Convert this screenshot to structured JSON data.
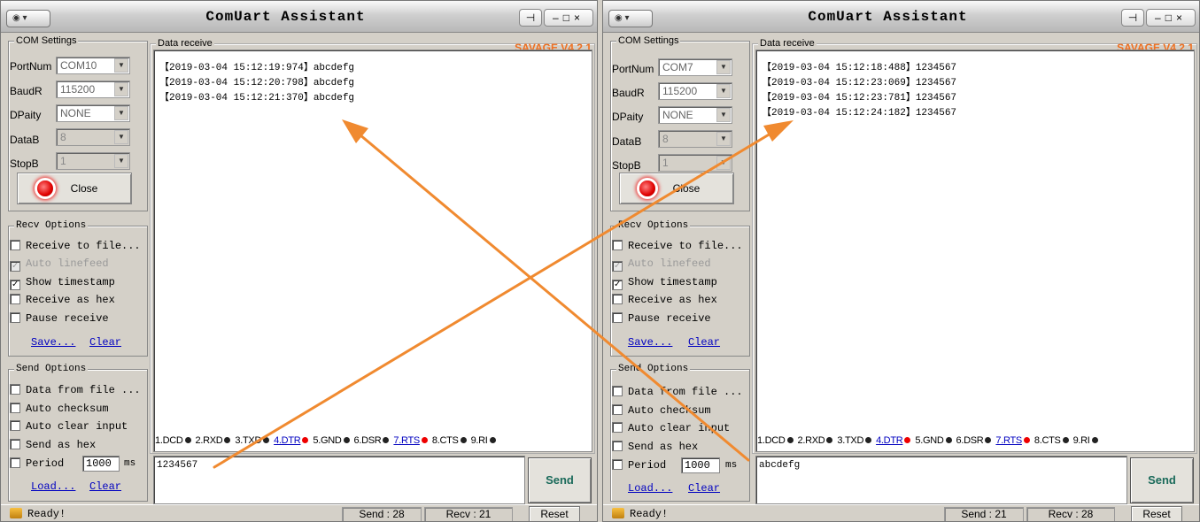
{
  "windows": [
    {
      "title": "ComUart Assistant",
      "brand": "SAVAGE V4.2.1",
      "com_settings": {
        "group_label": "COM Settings",
        "port_label": "PortNum",
        "port_value": "COM10",
        "baud_label": "BaudR",
        "baud_value": "115200",
        "parity_label": "DPaity",
        "parity_value": "NONE",
        "databits_label": "DataB",
        "databits_value": "8",
        "stopbits_label": "StopB",
        "stopbits_value": "1",
        "close_label": "Close"
      },
      "recv_options": {
        "group_label": "Recv Options",
        "items": [
          {
            "label": "Receive to file...",
            "checked": false,
            "disabled": false
          },
          {
            "label": "Auto linefeed",
            "checked": true,
            "disabled": true
          },
          {
            "label": "Show timestamp",
            "checked": true,
            "disabled": false
          },
          {
            "label": "Receive as hex",
            "checked": false,
            "disabled": false
          },
          {
            "label": "Pause receive",
            "checked": false,
            "disabled": false
          }
        ],
        "save_label": "Save...",
        "clear_label": "Clear"
      },
      "send_options": {
        "group_label": "Send Options",
        "items": [
          {
            "label": "Data from file ...",
            "checked": false
          },
          {
            "label": "Auto checksum",
            "checked": false
          },
          {
            "label": "Auto clear input",
            "checked": false
          },
          {
            "label": "Send as hex",
            "checked": false
          }
        ],
        "period_label": "Period",
        "period_value": "1000",
        "period_unit": "ms",
        "load_label": "Load...",
        "clear_label": "Clear"
      },
      "data_receive": {
        "group_label": "Data receive",
        "lines": [
          "【2019-03-04 15:12:19:974】abcdefg",
          "【2019-03-04 15:12:20:798】abcdefg",
          "【2019-03-04 15:12:21:370】abcdefg"
        ]
      },
      "pins": [
        "1.DCD",
        "2.RXD",
        "3.TXD",
        "4.DTR",
        "5.GND",
        "6.DSR",
        "7.RTS",
        "8.CTS",
        "9.RI"
      ],
      "send_text": "1234567",
      "send_label": "Send",
      "status": {
        "ready": "Ready!",
        "send": "Send : 28",
        "recv": "Recv : 21",
        "reset": "Reset"
      }
    },
    {
      "title": "ComUart Assistant",
      "brand": "SAVAGE V4.2.1",
      "com_settings": {
        "group_label": "COM Settings",
        "port_label": "PortNum",
        "port_value": "COM7",
        "baud_label": "BaudR",
        "baud_value": "115200",
        "parity_label": "DPaity",
        "parity_value": "NONE",
        "databits_label": "DataB",
        "databits_value": "8",
        "stopbits_label": "StopB",
        "stopbits_value": "1",
        "close_label": "Close"
      },
      "recv_options": {
        "group_label": "Recv Options",
        "items": [
          {
            "label": "Receive to file...",
            "checked": false,
            "disabled": false
          },
          {
            "label": "Auto linefeed",
            "checked": true,
            "disabled": true
          },
          {
            "label": "Show timestamp",
            "checked": true,
            "disabled": false
          },
          {
            "label": "Receive as hex",
            "checked": false,
            "disabled": false
          },
          {
            "label": "Pause receive",
            "checked": false,
            "disabled": false
          }
        ],
        "save_label": "Save...",
        "clear_label": "Clear"
      },
      "send_options": {
        "group_label": "Send Options",
        "items": [
          {
            "label": "Data from file ...",
            "checked": false
          },
          {
            "label": "Auto checksum",
            "checked": false
          },
          {
            "label": "Auto clear input",
            "checked": false
          },
          {
            "label": "Send as hex",
            "checked": false
          }
        ],
        "period_label": "Period",
        "period_value": "1000",
        "period_unit": "ms",
        "load_label": "Load...",
        "clear_label": "Clear"
      },
      "data_receive": {
        "group_label": "Data receive",
        "lines": [
          "【2019-03-04 15:12:18:488】1234567",
          "【2019-03-04 15:12:23:069】1234567",
          "【2019-03-04 15:12:23:781】1234567",
          "【2019-03-04 15:12:24:182】1234567"
        ]
      },
      "pins": [
        "1.DCD",
        "2.RXD",
        "3.TXD",
        "4.DTR",
        "5.GND",
        "6.DSR",
        "7.RTS",
        "8.CTS",
        "9.RI"
      ],
      "send_text": "abcdefg",
      "send_label": "Send",
      "status": {
        "ready": "Ready!",
        "send": "Send : 21",
        "recv": "Recv : 28",
        "reset": "Reset"
      }
    }
  ],
  "colors": {
    "accent": "#f07020",
    "arrow": "#f08a30",
    "link": "#0000c0",
    "led": "#e00000"
  }
}
